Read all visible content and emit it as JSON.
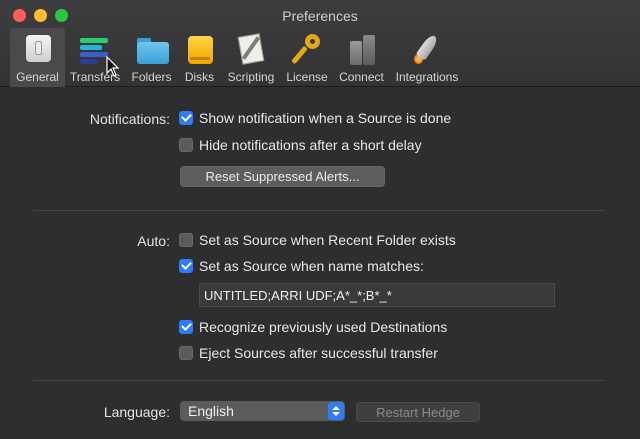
{
  "window": {
    "title": "Preferences"
  },
  "toolbar": {
    "items": [
      {
        "label": "General",
        "icon": "general-switch-icon",
        "selected": true
      },
      {
        "label": "Transfers",
        "icon": "transfers-bars-icon"
      },
      {
        "label": "Folders",
        "icon": "folder-icon"
      },
      {
        "label": "Disks",
        "icon": "disk-icon"
      },
      {
        "label": "Scripting",
        "icon": "script-page-icon"
      },
      {
        "label": "License",
        "icon": "key-icon"
      },
      {
        "label": "Connect",
        "icon": "connect-servers-icon"
      },
      {
        "label": "Integrations",
        "icon": "rocket-icon"
      }
    ]
  },
  "notifications": {
    "label": "Notifications:",
    "show_when_done": {
      "label": "Show notification when a Source is done",
      "checked": true
    },
    "hide_after_delay": {
      "label": "Hide notifications after a short delay",
      "checked": false
    },
    "reset_button": "Reset Suppressed Alerts..."
  },
  "auto": {
    "label": "Auto:",
    "recent_folder": {
      "label": "Set as Source when Recent Folder exists",
      "checked": false
    },
    "name_matches": {
      "label": "Set as Source when name matches:",
      "checked": true
    },
    "pattern_value": "UNTITLED;ARRI UDF;A*_*;B*_*",
    "recognize_destinations": {
      "label": "Recognize previously used Destinations",
      "checked": true
    },
    "eject_sources": {
      "label": "Eject Sources after successful transfer",
      "checked": false
    }
  },
  "language": {
    "label": "Language:",
    "selected": "English",
    "restart_button": "Restart Hedge"
  },
  "colors": {
    "accent": "#2f7cf6",
    "background": "#2e2e30"
  }
}
